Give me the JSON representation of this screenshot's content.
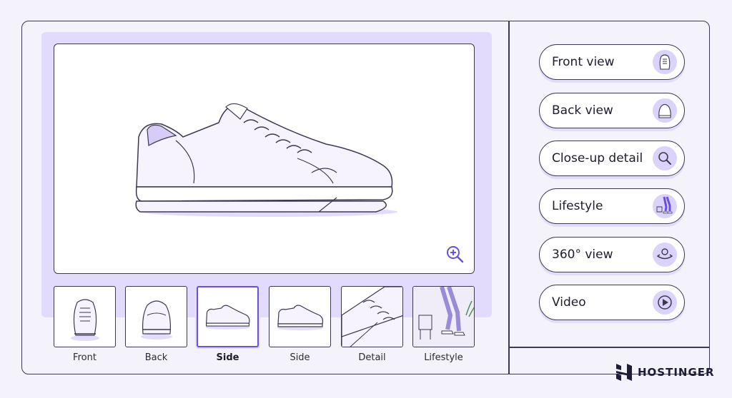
{
  "viewer": {
    "main_image": "sneaker side view",
    "zoom_icon": "zoom-in-icon"
  },
  "thumbnails": [
    {
      "label": "Front",
      "selected": false
    },
    {
      "label": "Back",
      "selected": false
    },
    {
      "label": "Side",
      "selected": true
    },
    {
      "label": "Side",
      "selected": false
    },
    {
      "label": "Detail",
      "selected": false
    },
    {
      "label": "Lifestyle",
      "selected": false
    }
  ],
  "options": [
    {
      "label": "Front view",
      "icon": "shoe-front-icon"
    },
    {
      "label": "Back view",
      "icon": "shoe-back-icon"
    },
    {
      "label": "Close-up detail",
      "icon": "magnifier-icon"
    },
    {
      "label": "Lifestyle",
      "icon": "lifestyle-icon"
    },
    {
      "label": "360° view",
      "icon": "rotate-360-icon"
    },
    {
      "label": "Video",
      "icon": "play-icon"
    }
  ],
  "brand": {
    "name": "HOSTINGER"
  },
  "colors": {
    "accent": "#6c4fdc",
    "accent_light": "#e3dbfb",
    "outline": "#3b3a4e",
    "background": "#f4f3fb"
  }
}
